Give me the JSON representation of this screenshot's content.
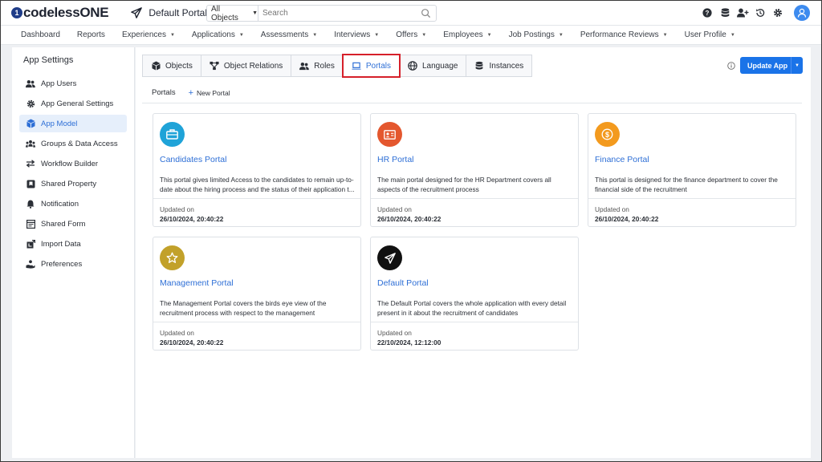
{
  "app": {
    "logo_mark": "1",
    "logo_text": "codelessONE",
    "portal_name": "Default Portal"
  },
  "search": {
    "scope": "All Objects",
    "placeholder": "Search"
  },
  "topbar_icons": [
    "help-icon",
    "database-icon",
    "add-user-icon",
    "history-icon",
    "settings-icon",
    "user-avatar-icon"
  ],
  "nav": {
    "items": [
      {
        "label": "Dashboard",
        "dropdown": false
      },
      {
        "label": "Reports",
        "dropdown": false
      },
      {
        "label": "Experiences",
        "dropdown": true
      },
      {
        "label": "Applications",
        "dropdown": true
      },
      {
        "label": "Assessments",
        "dropdown": true
      },
      {
        "label": "Interviews",
        "dropdown": true
      },
      {
        "label": "Offers",
        "dropdown": true
      },
      {
        "label": "Employees",
        "dropdown": true
      },
      {
        "label": "Job Postings",
        "dropdown": true
      },
      {
        "label": "Performance Reviews",
        "dropdown": true
      },
      {
        "label": "User Profile",
        "dropdown": true
      }
    ]
  },
  "sidebar": {
    "title": "App Settings",
    "items": [
      {
        "label": "App Users",
        "icon": "users-icon",
        "active": false
      },
      {
        "label": "App General Settings",
        "icon": "gear-icon",
        "active": false
      },
      {
        "label": "App Model",
        "icon": "cube-icon",
        "active": true
      },
      {
        "label": "Groups & Data Access",
        "icon": "groups-icon",
        "active": false
      },
      {
        "label": "Workflow Builder",
        "icon": "arrows-icon",
        "active": false
      },
      {
        "label": "Shared Property",
        "icon": "bookmark-box-icon",
        "active": false
      },
      {
        "label": "Notification",
        "icon": "bell-icon",
        "active": false
      },
      {
        "label": "Shared Form",
        "icon": "form-icon",
        "active": false
      },
      {
        "label": "Import Data",
        "icon": "import-icon",
        "active": false
      },
      {
        "label": "Preferences",
        "icon": "hand-user-icon",
        "active": false
      }
    ]
  },
  "tabs": [
    {
      "label": "Objects",
      "icon": "cube-icon",
      "active": false
    },
    {
      "label": "Object Relations",
      "icon": "relations-icon",
      "active": false
    },
    {
      "label": "Roles",
      "icon": "users-icon",
      "active": false
    },
    {
      "label": "Portals",
      "icon": "laptop-icon",
      "active": true
    },
    {
      "label": "Language",
      "icon": "globe-icon",
      "active": false
    },
    {
      "label": "Instances",
      "icon": "database-icon",
      "active": false
    }
  ],
  "toolbar": {
    "update_label": "Update App"
  },
  "subbar": {
    "label": "Portals",
    "new_portal": "New Portal"
  },
  "cards_updated_label": "Updated on",
  "cards": [
    {
      "title": "Candidates Portal",
      "description": "This portal gives limited Access to the candidates to remain up-to-date about the hiring process and the status of their application t...",
      "updated": "26/10/2024, 20:40:22",
      "icon": "briefcase-icon",
      "color": "#1fa3d8"
    },
    {
      "title": "HR Portal",
      "description": "The main portal designed for the HR Department covers all aspects of the recruitment process",
      "updated": "26/10/2024, 20:40:22",
      "icon": "id-card-icon",
      "color": "#e4572e"
    },
    {
      "title": "Finance Portal",
      "description": "This portal is designed for the finance department to cover the financial side of the recruitment",
      "updated": "26/10/2024, 20:40:22",
      "icon": "dollar-icon",
      "color": "#f39a1e"
    },
    {
      "title": "Management Portal",
      "description": "The Management Portal covers the birds eye view of the recruitment process with respect to the management",
      "updated": "26/10/2024, 20:40:22",
      "icon": "star-icon",
      "color": "#c2a12a"
    },
    {
      "title": "Default Portal",
      "description": "The Default Portal covers the whole application with every detail present in it about the recruitment of candidates",
      "updated": "22/10/2024, 12:12:00",
      "icon": "paper-plane-icon",
      "color": "#111111"
    }
  ],
  "colors": {
    "accent": "#1a73e8",
    "link": "#2e6fd6",
    "highlight_box": "#d6202a"
  }
}
